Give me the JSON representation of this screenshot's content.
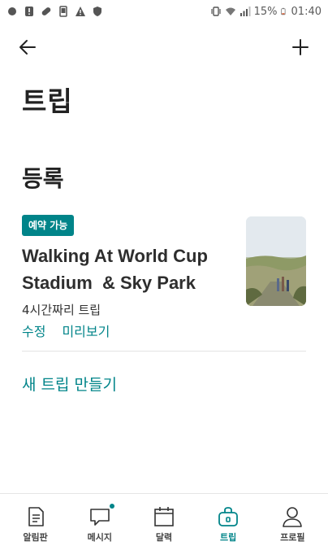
{
  "status_bar": {
    "battery": "15%",
    "time": "01:40",
    "left_icons": [
      "dot-icon",
      "alert-icon",
      "pill-icon",
      "phone-icon",
      "warning-icon",
      "shield-icon"
    ],
    "right_icons": [
      "vibrate-icon",
      "wifi-icon",
      "signal-icon",
      "battery-icon"
    ]
  },
  "app_bar": {
    "back_icon": "arrow-left-icon",
    "add_icon": "plus-icon"
  },
  "page": {
    "title": "트립",
    "section_title": "등록"
  },
  "trip": {
    "badge": "예약 가능",
    "name_line1": "Walking At World Cup",
    "name_line2": "Stadium  & Sky Park",
    "duration": "4시간짜리 트립",
    "edit_label": "수정",
    "preview_label": "미리보기"
  },
  "create_trip_label": "새 트립 만들기",
  "bottom_nav": {
    "items": [
      {
        "label": "알림판",
        "icon": "document-icon",
        "active": false
      },
      {
        "label": "메시지",
        "icon": "chat-icon",
        "active": false,
        "has_dot": true
      },
      {
        "label": "달력",
        "icon": "calendar-icon",
        "active": false
      },
      {
        "label": "트립",
        "icon": "bag-icon",
        "active": true
      },
      {
        "label": "프로필",
        "icon": "profile-icon",
        "active": false
      }
    ]
  },
  "colors": {
    "accent": "#008489",
    "text": "#222222",
    "divider": "#e4e4e4"
  }
}
